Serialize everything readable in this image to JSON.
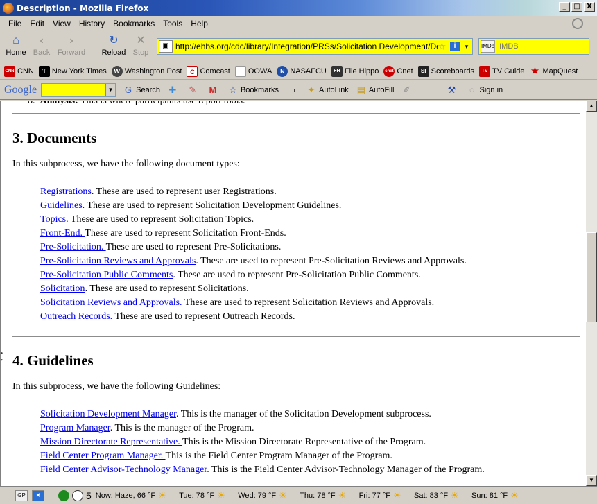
{
  "window": {
    "title": "Description - Mozilla Firefox",
    "minimize": "_",
    "maximize": "□",
    "close": "X"
  },
  "menu": [
    "File",
    "Edit",
    "View",
    "History",
    "Bookmarks",
    "Tools",
    "Help"
  ],
  "nav": {
    "home": "Home",
    "back": "Back",
    "forward": "Forward",
    "reload": "Reload",
    "stop": "Stop"
  },
  "url": "http://ehbs.org/cdc/library/Integration/PRSs/Solicitation Development/Descr",
  "search_placeholder": "IMDB",
  "search_engine_label": "IMDb",
  "bookmarks": [
    {
      "label": "CNN",
      "icon": "CNN",
      "color": "#cc0000"
    },
    {
      "label": "New York Times",
      "icon": "T",
      "color": "#000000"
    },
    {
      "label": "Washington Post",
      "icon": "W",
      "color": "#333333"
    },
    {
      "label": "Comcast",
      "icon": "C",
      "color": "#cc0000"
    },
    {
      "label": "OOWA",
      "icon": "",
      "color": "#ffffff"
    },
    {
      "label": "NASAFCU",
      "icon": "N",
      "color": "#1f4ea8"
    },
    {
      "label": "File Hippo",
      "icon": "FH",
      "color": "#333333"
    },
    {
      "label": "Cnet",
      "icon": "cnet",
      "color": "#cc0000"
    },
    {
      "label": "Scoreboards",
      "icon": "SI",
      "color": "#222222"
    },
    {
      "label": "TV Guide",
      "icon": "TV",
      "color": "#cc0000"
    },
    {
      "label": "MapQuest",
      "icon": "★",
      "color": "#cc0000"
    }
  ],
  "google_toolbar": {
    "logo": "Google",
    "search_label": "Search",
    "bookmarks_label": "Bookmarks",
    "autolink_label": "AutoLink",
    "autofill_label": "AutoFill",
    "signin_label": "Sign in"
  },
  "content": {
    "prev_item_number": "8.",
    "prev_item_bold": "Analysis:",
    "prev_item_text": " This is where participants use report tools.",
    "documents": {
      "heading": "3. Documents",
      "intro": "In this subprocess, we have the following document types:",
      "items": [
        {
          "link": "Registrations",
          "text": ". These are used to represent user Registrations."
        },
        {
          "link": "Guidelines",
          "text": ". These are used to represent Solicitation Development Guidelines."
        },
        {
          "link": "Topics",
          "text": ". These are used to represent Solicitation Topics."
        },
        {
          "link": "Front-End. ",
          "text": "These are used to represent Solicitation Front-Ends."
        },
        {
          "link": "Pre-Solicitation. ",
          "text": "These are used to represent Pre-Solicitations."
        },
        {
          "link": "Pre-Solicitation Reviews and Approvals",
          "text": ". These are used to represent Pre-Solicitation Reviews and Approvals."
        },
        {
          "link": "Pre-Solicitation Public Comments",
          "text": ". These are used to represent Pre-Solicitation Public Comments."
        },
        {
          "link": "Solicitation",
          "text": ". These are used to represent Solicitations."
        },
        {
          "link": "Solicitation Reviews and Approvals. ",
          "text": "These are used to represent Solicitation Reviews and Approvals."
        },
        {
          "link": "Outreach Records. ",
          "text": "These are used to represent Outreach Records."
        }
      ]
    },
    "guidelines": {
      "heading": "4. Guidelines",
      "intro": "In this subprocess, we have the following Guidelines:",
      "items": [
        {
          "link": "Solicitation Development Manager",
          "text": ". This is the manager of the Solicitation Development subprocess."
        },
        {
          "link": "Program Manager",
          "text": ". This is the manager of the Program."
        },
        {
          "link": "Mission Directorate Representative. ",
          "text": "This is the Mission Directorate Representative of the Program."
        },
        {
          "link": "Field Center Program Manager. ",
          "text": "This is the Field Center Program Manager of the Program."
        },
        {
          "link": "Field Center Advisor-Technology Manager. ",
          "text": "This is the Field Center Advisor-Technology Manager of the Program."
        }
      ]
    }
  },
  "status": {
    "gp": "GP",
    "num": "5",
    "weather": [
      "Now: Haze, 66 °F",
      "Tue: 78 °F",
      "Wed: 79 °F",
      "Thu: 78 °F",
      "Fri: 77 °F",
      "Sat: 83 °F",
      "Sun: 81 °F"
    ]
  }
}
